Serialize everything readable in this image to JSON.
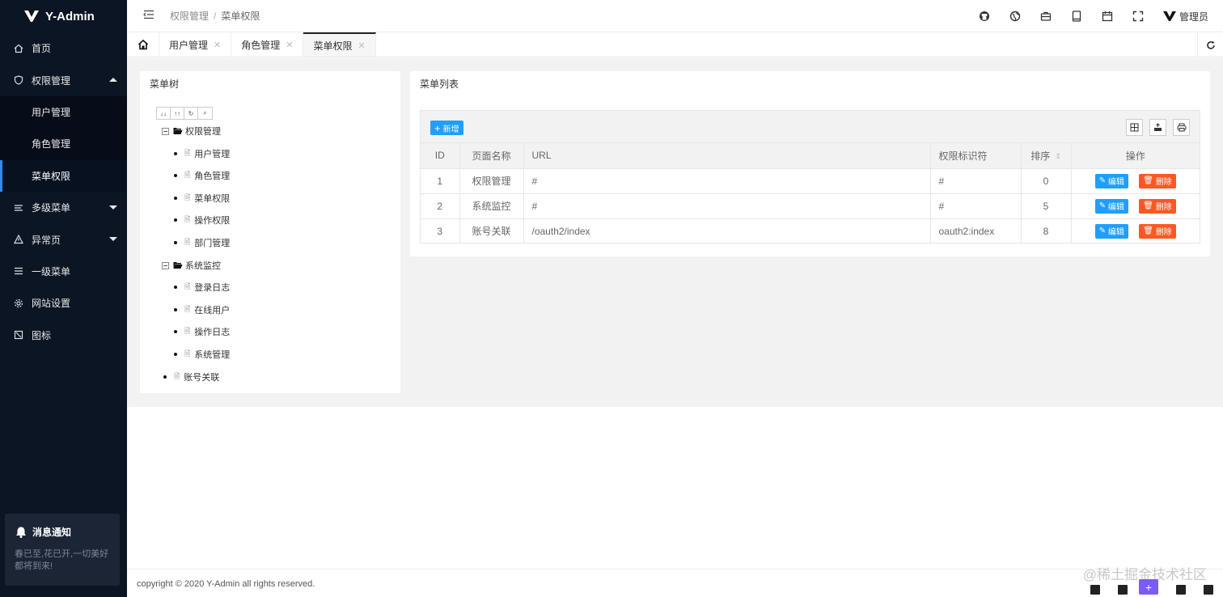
{
  "app": {
    "name": "Y-Admin"
  },
  "sidebar": {
    "items": [
      {
        "label": "首页",
        "icon": "home-icon"
      },
      {
        "label": "权限管理",
        "icon": "shield-icon",
        "expanded": true,
        "children": [
          {
            "label": "用户管理"
          },
          {
            "label": "角色管理"
          },
          {
            "label": "菜单权限",
            "active": true
          }
        ]
      },
      {
        "label": "多级菜单",
        "icon": "list-icon",
        "expanded": false
      },
      {
        "label": "异常页",
        "icon": "warning-icon",
        "expanded": false
      },
      {
        "label": "一级菜单",
        "icon": "menu-icon"
      },
      {
        "label": "网站设置",
        "icon": "gear-icon"
      },
      {
        "label": "图标",
        "icon": "tag-icon"
      }
    ],
    "notice": {
      "title": "消息通知",
      "text": "春已至,花已开,一切美好都将到来!"
    }
  },
  "header": {
    "breadcrumb": [
      "权限管理",
      "菜单权限"
    ],
    "user": "管理员",
    "icons": [
      "github-icon",
      "globe-icon",
      "briefcase-icon",
      "tablet-icon",
      "calendar-icon",
      "fullscreen-icon"
    ]
  },
  "tabs": {
    "items": [
      {
        "label": "用户管理"
      },
      {
        "label": "角色管理"
      },
      {
        "label": "菜单权限",
        "active": true
      }
    ]
  },
  "tree_card": {
    "title": "菜单树",
    "nodes": [
      {
        "label": "权限管理",
        "type": "folder"
      },
      {
        "label": "用户管理",
        "type": "leaf"
      },
      {
        "label": "角色管理",
        "type": "leaf"
      },
      {
        "label": "菜单权限",
        "type": "leaf"
      },
      {
        "label": "操作权限",
        "type": "leaf"
      },
      {
        "label": "部门管理",
        "type": "leaf"
      },
      {
        "label": "系统监控",
        "type": "folder"
      },
      {
        "label": "登录日志",
        "type": "leaf"
      },
      {
        "label": "在线用户",
        "type": "leaf"
      },
      {
        "label": "操作日志",
        "type": "leaf"
      },
      {
        "label": "系统管理",
        "type": "leaf"
      },
      {
        "label": "账号关联",
        "type": "leaf"
      }
    ]
  },
  "list_card": {
    "title": "菜单列表",
    "add_label": "新增",
    "columns": [
      "ID",
      "页面名称",
      "URL",
      "权限标识符",
      "排序",
      "操作"
    ],
    "rows": [
      {
        "id": "1",
        "name": "权限管理",
        "url": "#",
        "perm": "#",
        "sort": "0"
      },
      {
        "id": "2",
        "name": "系统监控",
        "url": "#",
        "perm": "#",
        "sort": "5"
      },
      {
        "id": "3",
        "name": "账号关联",
        "url": "/oauth2/index",
        "perm": "oauth2:index",
        "sort": "8"
      }
    ],
    "edit_label": "编辑",
    "delete_label": "删除"
  },
  "footer": {
    "copyright": "copyright © 2020 Y-Admin all rights reserved.",
    "watermark": "@稀土掘金技术社区"
  },
  "colors": {
    "sidebar_bg": "#0c1524",
    "primary": "#1e9fff",
    "danger": "#ff5722",
    "accent": "#7a5af8"
  }
}
